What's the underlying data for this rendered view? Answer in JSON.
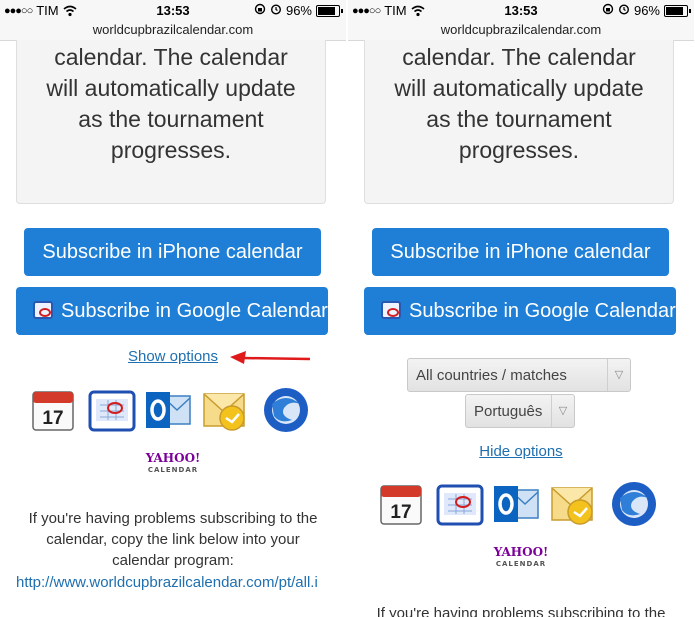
{
  "status": {
    "carrier": "TIM",
    "time": "13:53",
    "battery": "96%",
    "battery_level": 0.96
  },
  "url": "worldcupbrazilcalendar.com",
  "card": {
    "lines": [
      "calendar. The calendar",
      "will automatically update",
      "as the tournament",
      "progresses."
    ]
  },
  "buttons": {
    "iphone": "Subscribe in iPhone calendar",
    "google": "Subscribe in Google Calendar"
  },
  "left": {
    "show_options": "Show options"
  },
  "right": {
    "country_select": "All countries / matches",
    "language_select": "Português",
    "hide_options": "Hide options"
  },
  "yahoo": {
    "logo": "YAHOO!",
    "sub": "CALENDAR"
  },
  "problem": {
    "lines": [
      "If you're having problems subscribing to the",
      "calendar, copy the link below into your",
      "calendar program:"
    ],
    "right_partial": "If you're having problems subscribing to the",
    "url": "http://www.worldcupbrazilcalendar.com/pt/all.i"
  },
  "colors": {
    "button_blue": "#1f7fd6",
    "link_blue": "#1e6fb0",
    "arrow_red": "#e01a1a"
  },
  "icons": [
    "ical-icon",
    "google-calendar-icon",
    "outlook-icon",
    "outlook-calendar-icon",
    "thunderbird-icon"
  ]
}
